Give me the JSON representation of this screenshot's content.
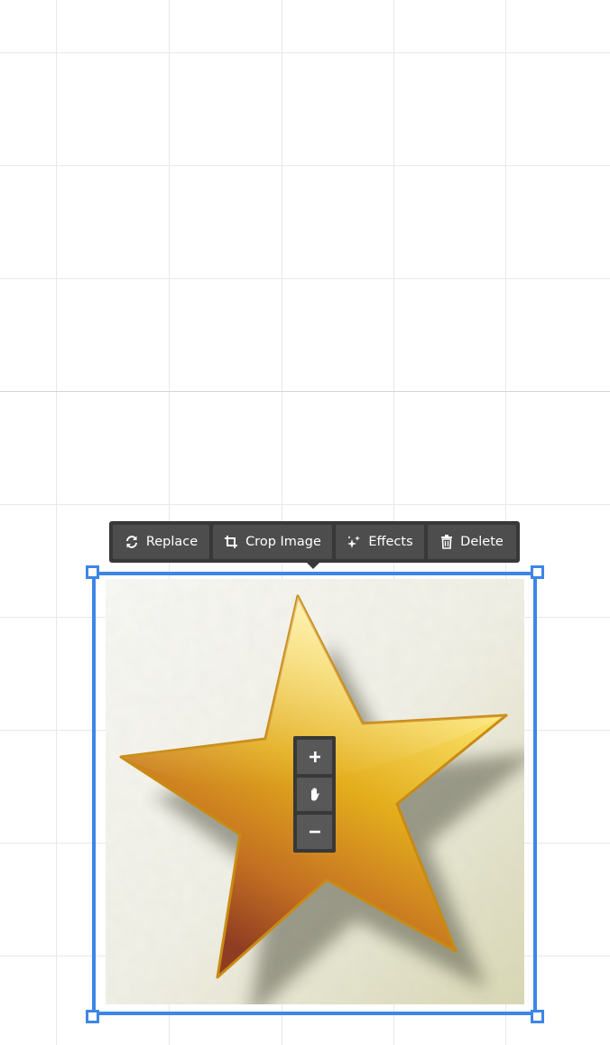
{
  "toolbar": {
    "replace_label": "Replace",
    "crop_label": "Crop Image",
    "effects_label": "Effects",
    "delete_label": "Delete"
  },
  "icons": {
    "replace": "replace-icon",
    "crop": "crop-icon",
    "effects": "sparkle-icon",
    "delete": "trash-icon",
    "zoom_in": "plus-icon",
    "pan": "hand-icon",
    "zoom_out": "minus-icon"
  },
  "colors": {
    "selection": "#3d86e6",
    "toolbar_bg": "#383838",
    "button_bg": "#4d4d4d",
    "grid_line": "#e6e6e6"
  }
}
